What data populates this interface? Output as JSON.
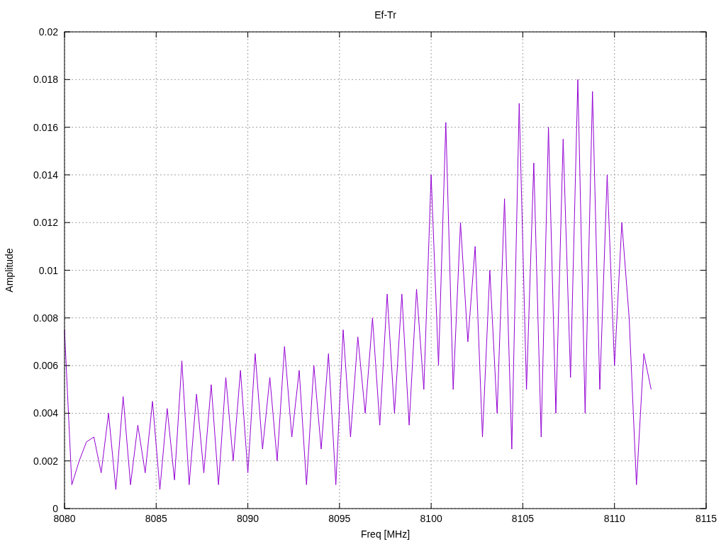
{
  "chart_data": {
    "type": "line",
    "grid": true,
    "title": "Ef-Tr",
    "xlabel": "Freq [MHz]",
    "ylabel": "Amplitude",
    "xlim": [
      8080,
      8115
    ],
    "ylim": [
      0,
      0.02
    ],
    "xticks": [
      8080,
      8085,
      8090,
      8095,
      8100,
      8105,
      8110,
      8115
    ],
    "yticks": [
      0,
      0.002,
      0.004,
      0.006,
      0.008,
      0.01,
      0.012,
      0.014,
      0.016,
      0.018,
      0.02
    ],
    "x": [
      8080,
      8080.4,
      8080.8,
      8081.2,
      8081.6,
      8082,
      8082.4,
      8082.8,
      8083.2,
      8083.6,
      8084,
      8084.4,
      8084.8,
      8085.2,
      8085.6,
      8086,
      8086.4,
      8086.8,
      8087.2,
      8087.6,
      8088,
      8088.4,
      8088.8,
      8089.2,
      8089.6,
      8090,
      8090.4,
      8090.8,
      8091.2,
      8091.6,
      8092,
      8092.4,
      8092.8,
      8093.2,
      8093.6,
      8094,
      8094.4,
      8094.8,
      8095.2,
      8095.6,
      8096,
      8096.4,
      8096.8,
      8097.2,
      8097.6,
      8098,
      8098.4,
      8098.8,
      8099.2,
      8099.6,
      8100,
      8100.4,
      8100.8,
      8101.2,
      8101.6,
      8102,
      8102.4,
      8102.8,
      8103.2,
      8103.6,
      8104,
      8104.4,
      8104.8,
      8105.2,
      8105.6,
      8106,
      8106.4,
      8106.8,
      8107.2,
      8107.6,
      8108,
      8108.4,
      8108.8,
      8109.2,
      8109.6,
      8110,
      8110.4,
      8110.8,
      8111.2,
      8111.6,
      8112
    ],
    "series": [
      {
        "color": "#9400d3",
        "values": [
          0.0075,
          0.001,
          0.002,
          0.0028,
          0.003,
          0.0015,
          0.004,
          0.0008,
          0.0047,
          0.001,
          0.0035,
          0.0015,
          0.0045,
          0.0008,
          0.0042,
          0.0012,
          0.0062,
          0.001,
          0.0048,
          0.0015,
          0.0052,
          0.001,
          0.0055,
          0.002,
          0.0058,
          0.0015,
          0.0065,
          0.0025,
          0.0055,
          0.002,
          0.0068,
          0.003,
          0.0058,
          0.001,
          0.006,
          0.0025,
          0.0065,
          0.001,
          0.0075,
          0.003,
          0.0072,
          0.004,
          0.008,
          0.0035,
          0.009,
          0.004,
          0.009,
          0.0035,
          0.0092,
          0.005,
          0.014,
          0.006,
          0.0162,
          0.005,
          0.012,
          0.007,
          0.011,
          0.003,
          0.01,
          0.004,
          0.013,
          0.0025,
          0.017,
          0.005,
          0.0145,
          0.003,
          0.016,
          0.004,
          0.0155,
          0.0055,
          0.018,
          0.004,
          0.0175,
          0.005,
          0.014,
          0.006,
          0.012,
          0.008,
          0.001,
          0.0065,
          0.005
        ]
      }
    ]
  }
}
